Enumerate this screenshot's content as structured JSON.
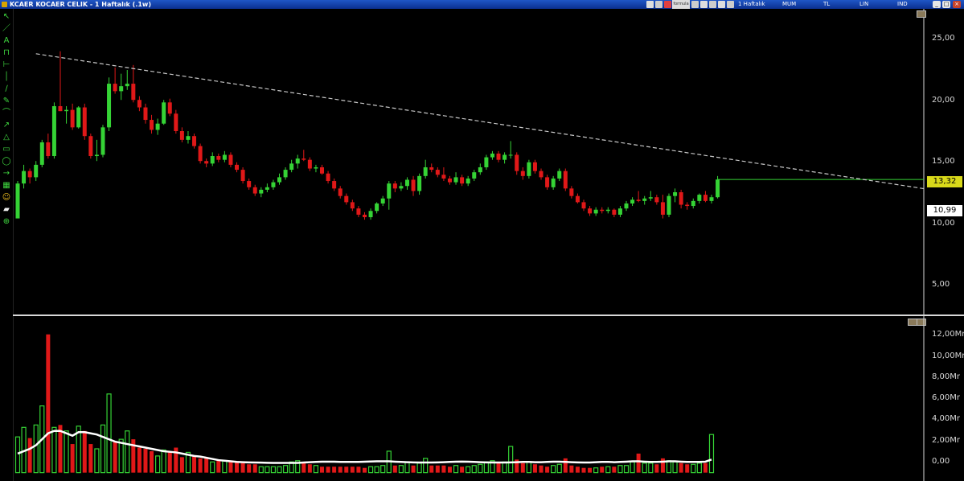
{
  "window": {
    "title": "KCAER KOCAER CELIK - 1 Haftalık (.1w)",
    "toolbar": {
      "period": "1 Haftalık",
      "candle_type": "MUM",
      "currency": "TL",
      "scale": "LIN",
      "indicator": "IND",
      "formul_label": "formula"
    },
    "controls": {
      "minimize": "_",
      "maximize": "□",
      "close": "×"
    }
  },
  "colors": {
    "up": "#35d335",
    "down": "#e01818",
    "trendline": "#c8c8c8",
    "moving_average": "#ffffff",
    "last_price_bg": "#d9d91a",
    "horizontal_line": "#35d335"
  },
  "price_panel": {
    "last_price_label": "13,32",
    "marker_price_label": "10,99",
    "y_ticks": [
      "25,00",
      "20,00",
      "15,00",
      "10,00",
      "5,00"
    ]
  },
  "volume_panel": {
    "y_ticks": [
      "12,00Mr",
      "10,00Mr",
      "8,00Mr",
      "6,00Mr",
      "4,00Mr",
      "2,00Mr",
      "0,00"
    ]
  },
  "tools": [
    "cursor-icon",
    "trendline-icon",
    "text-icon",
    "channel-icon",
    "horizontal-line-icon",
    "vertical-line-icon",
    "fibonacci-icon",
    "pen-icon",
    "arc-icon",
    "ray-icon",
    "triangle-icon",
    "rectangle-icon",
    "ellipse-icon",
    "arrow-icon",
    "gann-icon",
    "smiley-icon",
    "eraser-icon",
    "zoom-icon"
  ],
  "chart_data": [
    {
      "type": "candlestick",
      "ylim": [
        2.5,
        27.0
      ],
      "trendline": {
        "start": {
          "index": 3,
          "price": 23.4
        },
        "end": {
          "index": 173,
          "price": 10.8
        }
      },
      "horizontal_line_price": 13.32,
      "candles": [
        [
          10.2,
          13.2,
          11.0,
          13.0
        ],
        [
          13.0,
          14.5,
          12.6,
          14.0
        ],
        [
          14.0,
          14.2,
          13.0,
          13.5
        ],
        [
          13.5,
          14.8,
          13.2,
          14.5
        ],
        [
          14.5,
          16.5,
          14.3,
          16.3
        ],
        [
          16.3,
          17.0,
          15.0,
          15.2
        ],
        [
          15.2,
          19.5,
          15.0,
          19.2
        ],
        [
          19.2,
          23.6,
          18.8,
          18.8
        ],
        [
          18.8,
          19.2,
          17.8,
          18.9
        ],
        [
          18.9,
          19.4,
          17.3,
          17.5
        ],
        [
          17.5,
          19.2,
          17.4,
          19.1
        ],
        [
          19.1,
          19.4,
          16.5,
          16.8
        ],
        [
          16.8,
          17.0,
          15.0,
          15.2
        ],
        [
          15.2,
          16.5,
          14.8,
          15.3
        ],
        [
          15.3,
          17.7,
          15.1,
          17.5
        ],
        [
          17.5,
          21.5,
          17.2,
          21.0
        ],
        [
          21.0,
          22.3,
          20.2,
          20.4
        ],
        [
          20.4,
          21.8,
          19.7,
          20.8
        ],
        [
          20.8,
          22.1,
          20.5,
          21.0
        ],
        [
          21.0,
          22.5,
          19.5,
          19.7
        ],
        [
          19.7,
          20.0,
          18.8,
          19.1
        ],
        [
          19.1,
          19.4,
          17.8,
          18.1
        ],
        [
          18.1,
          18.5,
          17.0,
          17.3
        ],
        [
          17.3,
          18.2,
          16.9,
          17.8
        ],
        [
          17.8,
          19.7,
          17.7,
          19.5
        ],
        [
          19.5,
          19.8,
          18.4,
          18.6
        ],
        [
          18.6,
          18.9,
          17.0,
          17.2
        ],
        [
          17.2,
          17.5,
          16.3,
          16.5
        ],
        [
          16.5,
          17.2,
          16.2,
          16.8
        ],
        [
          16.8,
          17.0,
          15.8,
          16.0
        ],
        [
          16.0,
          16.2,
          14.6,
          14.8
        ],
        [
          14.8,
          15.0,
          14.3,
          14.6
        ],
        [
          14.6,
          15.5,
          14.4,
          15.2
        ],
        [
          15.2,
          15.4,
          14.7,
          14.9
        ],
        [
          14.9,
          15.6,
          14.7,
          15.3
        ],
        [
          15.3,
          15.5,
          14.3,
          14.5
        ],
        [
          14.5,
          14.7,
          13.9,
          14.1
        ],
        [
          14.1,
          14.3,
          13.0,
          13.2
        ],
        [
          13.2,
          13.4,
          12.5,
          12.7
        ],
        [
          12.7,
          12.9,
          12.0,
          12.2
        ],
        [
          12.2,
          12.7,
          11.9,
          12.5
        ],
        [
          12.5,
          13.0,
          12.3,
          12.7
        ],
        [
          12.7,
          13.3,
          12.5,
          13.1
        ],
        [
          13.1,
          13.8,
          12.9,
          13.5
        ],
        [
          13.5,
          14.3,
          13.3,
          14.1
        ],
        [
          14.1,
          14.9,
          13.9,
          14.6
        ],
        [
          14.6,
          15.3,
          14.2,
          15.0
        ],
        [
          15.0,
          15.7,
          14.8,
          14.9
        ],
        [
          14.9,
          15.1,
          14.0,
          14.2
        ],
        [
          14.2,
          14.5,
          13.9,
          14.3
        ],
        [
          14.3,
          14.5,
          13.7,
          13.8
        ],
        [
          13.8,
          14.0,
          13.0,
          13.2
        ],
        [
          13.2,
          13.4,
          12.4,
          12.6
        ],
        [
          12.6,
          12.8,
          11.8,
          12.0
        ],
        [
          12.0,
          12.2,
          11.3,
          11.5
        ],
        [
          11.5,
          11.7,
          10.8,
          11.0
        ],
        [
          11.0,
          11.2,
          10.3,
          10.5
        ],
        [
          10.5,
          10.7,
          10.1,
          10.3
        ],
        [
          10.3,
          11.0,
          10.1,
          10.8
        ],
        [
          10.8,
          11.5,
          10.6,
          11.4
        ],
        [
          11.4,
          12.0,
          11.2,
          11.8
        ],
        [
          11.8,
          13.2,
          10.9,
          13.0
        ],
        [
          13.0,
          13.2,
          12.3,
          12.6
        ],
        [
          12.6,
          13.1,
          12.4,
          12.8
        ],
        [
          12.8,
          13.5,
          12.5,
          13.3
        ],
        [
          13.3,
          13.6,
          12.0,
          12.4
        ],
        [
          12.4,
          13.8,
          12.1,
          13.6
        ],
        [
          13.6,
          14.9,
          13.4,
          14.3
        ],
        [
          14.3,
          14.6,
          13.9,
          14.1
        ],
        [
          14.1,
          14.3,
          13.5,
          13.7
        ],
        [
          13.7,
          14.3,
          13.2,
          13.4
        ],
        [
          13.4,
          13.6,
          12.9,
          13.1
        ],
        [
          13.1,
          13.9,
          12.9,
          13.5
        ],
        [
          13.5,
          13.7,
          12.8,
          13.0
        ],
        [
          13.0,
          13.6,
          12.8,
          13.4
        ],
        [
          13.4,
          14.1,
          13.2,
          13.9
        ],
        [
          13.9,
          14.6,
          13.7,
          14.3
        ],
        [
          14.3,
          15.3,
          14.1,
          15.1
        ],
        [
          15.1,
          15.6,
          14.9,
          15.4
        ],
        [
          15.4,
          15.6,
          14.7,
          14.9
        ],
        [
          14.9,
          15.5,
          14.6,
          15.3
        ],
        [
          15.3,
          16.4,
          15.0,
          15.3
        ],
        [
          15.3,
          15.5,
          13.7,
          14.0
        ],
        [
          14.0,
          14.3,
          13.3,
          13.6
        ],
        [
          13.6,
          14.9,
          13.4,
          14.7
        ],
        [
          14.7,
          14.9,
          13.8,
          14.0
        ],
        [
          14.0,
          14.2,
          13.3,
          13.5
        ],
        [
          13.5,
          13.7,
          12.5,
          12.7
        ],
        [
          12.7,
          13.6,
          12.5,
          13.4
        ],
        [
          13.4,
          14.2,
          13.2,
          14.0
        ],
        [
          14.0,
          14.2,
          12.4,
          12.6
        ],
        [
          12.6,
          12.8,
          11.8,
          12.0
        ],
        [
          12.0,
          12.2,
          11.4,
          11.5
        ],
        [
          11.5,
          11.7,
          10.8,
          11.0
        ],
        [
          11.0,
          11.2,
          10.4,
          10.6
        ],
        [
          10.6,
          11.1,
          10.4,
          10.9
        ],
        [
          10.9,
          11.1,
          10.6,
          10.8
        ],
        [
          10.8,
          11.1,
          10.6,
          10.9
        ],
        [
          10.9,
          11.0,
          10.3,
          10.5
        ],
        [
          10.5,
          11.2,
          10.3,
          11.0
        ],
        [
          11.0,
          11.6,
          10.8,
          11.4
        ],
        [
          11.4,
          11.9,
          11.2,
          11.7
        ],
        [
          11.7,
          12.4,
          11.5,
          11.6
        ],
        [
          11.6,
          12.0,
          11.3,
          11.8
        ],
        [
          11.8,
          12.4,
          11.6,
          11.9
        ],
        [
          11.9,
          12.1,
          11.3,
          11.5
        ],
        [
          11.5,
          12.1,
          10.2,
          10.5
        ],
        [
          10.5,
          12.2,
          10.3,
          12.0
        ],
        [
          12.0,
          12.6,
          11.5,
          12.3
        ],
        [
          12.3,
          12.5,
          11.0,
          11.3
        ],
        [
          11.3,
          11.5,
          10.9,
          11.2
        ],
        [
          11.2,
          11.8,
          11.0,
          11.6
        ],
        [
          11.6,
          12.2,
          11.4,
          12.1
        ],
        [
          12.1,
          12.4,
          11.5,
          11.6
        ],
        [
          11.6,
          12.1,
          11.4,
          11.9
        ],
        [
          11.9,
          13.6,
          11.8,
          13.32
        ]
      ],
      "moving_average": [
        1.6,
        1.8,
        2.0,
        2.3,
        2.8,
        3.3,
        3.5,
        3.5,
        3.3,
        3.1,
        3.4,
        3.4,
        3.3,
        3.2,
        3.0,
        2.8,
        2.6,
        2.5,
        2.4,
        2.3,
        2.2,
        2.1,
        2.0,
        1.9,
        1.8,
        1.75,
        1.7,
        1.6,
        1.5,
        1.4,
        1.35,
        1.25,
        1.15,
        1.05,
        1.0,
        0.95,
        0.9,
        0.88,
        0.86,
        0.85,
        0.84,
        0.83,
        0.82,
        0.82,
        0.82,
        0.82,
        0.82,
        0.85,
        0.88,
        0.9,
        0.92,
        0.92,
        0.92,
        0.9,
        0.9,
        0.9,
        0.9,
        0.92,
        0.94,
        0.95,
        0.95,
        0.95,
        0.92,
        0.9,
        0.88,
        0.86,
        0.85,
        0.85,
        0.85,
        0.86,
        0.88,
        0.9,
        0.92,
        0.93,
        0.92,
        0.9,
        0.88,
        0.86,
        0.85,
        0.85,
        0.85,
        0.86,
        0.88,
        0.9,
        0.9,
        0.88,
        0.88,
        0.9,
        0.92,
        0.92,
        0.9,
        0.88,
        0.86,
        0.85,
        0.85,
        0.88,
        0.9,
        0.9,
        0.88,
        0.9,
        0.92,
        0.95,
        0.95,
        0.92,
        0.9,
        0.9,
        0.92,
        0.95,
        0.95,
        0.92,
        0.9,
        0.9,
        0.9,
        0.92,
        1.1
      ]
    },
    {
      "type": "bar",
      "name": "volume",
      "ylim": [
        -0.7,
        13.2
      ],
      "values": [
        3.0,
        3.8,
        2.9,
        4.0,
        5.6,
        11.6,
        3.8,
        4.0,
        3.5,
        2.4,
        3.9,
        3.5,
        2.4,
        2.0,
        4.0,
        6.6,
        2.6,
        2.8,
        3.5,
        2.8,
        2.1,
        2.0,
        1.8,
        1.4,
        1.9,
        1.8,
        2.1,
        1.3,
        1.7,
        1.4,
        1.2,
        1.3,
        0.9,
        1.1,
        1.0,
        0.9,
        0.9,
        0.8,
        0.7,
        0.7,
        0.5,
        0.5,
        0.5,
        0.5,
        0.6,
        0.9,
        1.0,
        0.8,
        0.7,
        0.6,
        0.5,
        0.5,
        0.5,
        0.5,
        0.5,
        0.5,
        0.5,
        0.4,
        0.5,
        0.5,
        0.6,
        1.8,
        0.6,
        0.6,
        0.9,
        0.6,
        0.8,
        1.2,
        0.6,
        0.6,
        0.6,
        0.5,
        0.6,
        0.5,
        0.5,
        0.6,
        0.7,
        0.9,
        1.0,
        0.8,
        0.9,
        2.2,
        1.1,
        0.8,
        0.9,
        0.7,
        0.6,
        0.5,
        0.6,
        0.7,
        1.2,
        0.6,
        0.5,
        0.4,
        0.4,
        0.4,
        0.5,
        0.5,
        0.5,
        0.6,
        0.6,
        0.9,
        1.6,
        0.8,
        0.8,
        0.7,
        1.2,
        1.0,
        0.9,
        0.8,
        0.7,
        0.7,
        0.8,
        0.8,
        3.2
      ]
    }
  ]
}
